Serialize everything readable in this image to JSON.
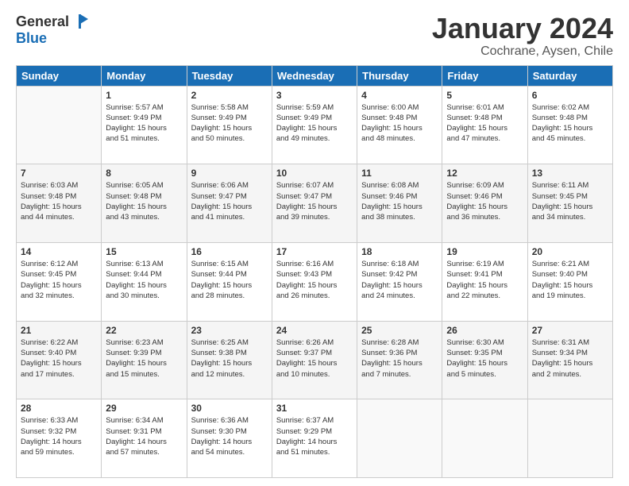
{
  "logo": {
    "general": "General",
    "blue": "Blue"
  },
  "title": "January 2024",
  "location": "Cochrane, Aysen, Chile",
  "days_header": [
    "Sunday",
    "Monday",
    "Tuesday",
    "Wednesday",
    "Thursday",
    "Friday",
    "Saturday"
  ],
  "weeks": [
    [
      {
        "day": "",
        "info": ""
      },
      {
        "day": "1",
        "info": "Sunrise: 5:57 AM\nSunset: 9:49 PM\nDaylight: 15 hours\nand 51 minutes."
      },
      {
        "day": "2",
        "info": "Sunrise: 5:58 AM\nSunset: 9:49 PM\nDaylight: 15 hours\nand 50 minutes."
      },
      {
        "day": "3",
        "info": "Sunrise: 5:59 AM\nSunset: 9:49 PM\nDaylight: 15 hours\nand 49 minutes."
      },
      {
        "day": "4",
        "info": "Sunrise: 6:00 AM\nSunset: 9:48 PM\nDaylight: 15 hours\nand 48 minutes."
      },
      {
        "day": "5",
        "info": "Sunrise: 6:01 AM\nSunset: 9:48 PM\nDaylight: 15 hours\nand 47 minutes."
      },
      {
        "day": "6",
        "info": "Sunrise: 6:02 AM\nSunset: 9:48 PM\nDaylight: 15 hours\nand 45 minutes."
      }
    ],
    [
      {
        "day": "7",
        "info": "Sunrise: 6:03 AM\nSunset: 9:48 PM\nDaylight: 15 hours\nand 44 minutes."
      },
      {
        "day": "8",
        "info": "Sunrise: 6:05 AM\nSunset: 9:48 PM\nDaylight: 15 hours\nand 43 minutes."
      },
      {
        "day": "9",
        "info": "Sunrise: 6:06 AM\nSunset: 9:47 PM\nDaylight: 15 hours\nand 41 minutes."
      },
      {
        "day": "10",
        "info": "Sunrise: 6:07 AM\nSunset: 9:47 PM\nDaylight: 15 hours\nand 39 minutes."
      },
      {
        "day": "11",
        "info": "Sunrise: 6:08 AM\nSunset: 9:46 PM\nDaylight: 15 hours\nand 38 minutes."
      },
      {
        "day": "12",
        "info": "Sunrise: 6:09 AM\nSunset: 9:46 PM\nDaylight: 15 hours\nand 36 minutes."
      },
      {
        "day": "13",
        "info": "Sunrise: 6:11 AM\nSunset: 9:45 PM\nDaylight: 15 hours\nand 34 minutes."
      }
    ],
    [
      {
        "day": "14",
        "info": "Sunrise: 6:12 AM\nSunset: 9:45 PM\nDaylight: 15 hours\nand 32 minutes."
      },
      {
        "day": "15",
        "info": "Sunrise: 6:13 AM\nSunset: 9:44 PM\nDaylight: 15 hours\nand 30 minutes."
      },
      {
        "day": "16",
        "info": "Sunrise: 6:15 AM\nSunset: 9:44 PM\nDaylight: 15 hours\nand 28 minutes."
      },
      {
        "day": "17",
        "info": "Sunrise: 6:16 AM\nSunset: 9:43 PM\nDaylight: 15 hours\nand 26 minutes."
      },
      {
        "day": "18",
        "info": "Sunrise: 6:18 AM\nSunset: 9:42 PM\nDaylight: 15 hours\nand 24 minutes."
      },
      {
        "day": "19",
        "info": "Sunrise: 6:19 AM\nSunset: 9:41 PM\nDaylight: 15 hours\nand 22 minutes."
      },
      {
        "day": "20",
        "info": "Sunrise: 6:21 AM\nSunset: 9:40 PM\nDaylight: 15 hours\nand 19 minutes."
      }
    ],
    [
      {
        "day": "21",
        "info": "Sunrise: 6:22 AM\nSunset: 9:40 PM\nDaylight: 15 hours\nand 17 minutes."
      },
      {
        "day": "22",
        "info": "Sunrise: 6:23 AM\nSunset: 9:39 PM\nDaylight: 15 hours\nand 15 minutes."
      },
      {
        "day": "23",
        "info": "Sunrise: 6:25 AM\nSunset: 9:38 PM\nDaylight: 15 hours\nand 12 minutes."
      },
      {
        "day": "24",
        "info": "Sunrise: 6:26 AM\nSunset: 9:37 PM\nDaylight: 15 hours\nand 10 minutes."
      },
      {
        "day": "25",
        "info": "Sunrise: 6:28 AM\nSunset: 9:36 PM\nDaylight: 15 hours\nand 7 minutes."
      },
      {
        "day": "26",
        "info": "Sunrise: 6:30 AM\nSunset: 9:35 PM\nDaylight: 15 hours\nand 5 minutes."
      },
      {
        "day": "27",
        "info": "Sunrise: 6:31 AM\nSunset: 9:34 PM\nDaylight: 15 hours\nand 2 minutes."
      }
    ],
    [
      {
        "day": "28",
        "info": "Sunrise: 6:33 AM\nSunset: 9:32 PM\nDaylight: 14 hours\nand 59 minutes."
      },
      {
        "day": "29",
        "info": "Sunrise: 6:34 AM\nSunset: 9:31 PM\nDaylight: 14 hours\nand 57 minutes."
      },
      {
        "day": "30",
        "info": "Sunrise: 6:36 AM\nSunset: 9:30 PM\nDaylight: 14 hours\nand 54 minutes."
      },
      {
        "day": "31",
        "info": "Sunrise: 6:37 AM\nSunset: 9:29 PM\nDaylight: 14 hours\nand 51 minutes."
      },
      {
        "day": "",
        "info": ""
      },
      {
        "day": "",
        "info": ""
      },
      {
        "day": "",
        "info": ""
      }
    ]
  ]
}
